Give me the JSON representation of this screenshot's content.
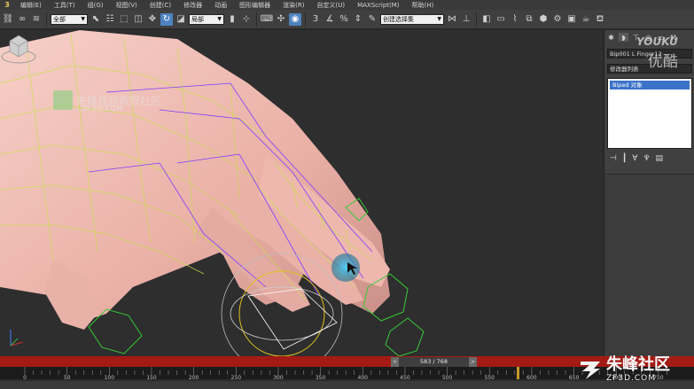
{
  "menubar": {
    "app_logo": "3",
    "items": [
      "编辑(E)",
      "工具(T)",
      "组(G)",
      "视图(V)",
      "创建(C)",
      "修改器",
      "动画",
      "图形编辑器",
      "渲染(R)",
      "自定义(U)",
      "MAXScript(M)",
      "帮助(H)"
    ]
  },
  "toolbar": {
    "selection_filter": "全部",
    "coord_system": "局部",
    "named_selection": "创建选择集",
    "spinner_snap_label": "3",
    "percent_snap_label": "%"
  },
  "viewport": {
    "watermark_text": "朱峰视频教程社区",
    "watermark_sub": "ZF3D.COM",
    "bg_color": "#2e2e2e",
    "mesh_color": "#c8e04a",
    "bone_color": "#7c3cff",
    "skin_color": "#f1b8ae"
  },
  "command_panel": {
    "tabs": [
      "create-icon",
      "modify-icon",
      "hierarchy-icon",
      "motion-icon",
      "display-icon",
      "utilities-icon"
    ],
    "object_name": "Bip001 L Finger13",
    "modifier_list": "修改器列表",
    "stack_item": "Biped 对象",
    "stack_icons": [
      "pin-icon",
      "show-end-icon",
      "make-unique-icon",
      "remove-modifier-icon",
      "configure-icon"
    ]
  },
  "timeline": {
    "frame_label": "583 / 768",
    "prev_label": "<",
    "next_label": ">",
    "current_frame": 583,
    "total_frames": 768,
    "ticks": [
      "0",
      "50",
      "100",
      "150",
      "200",
      "250",
      "300",
      "350",
      "400",
      "450",
      "500",
      "550",
      "600",
      "650",
      "700",
      "750"
    ],
    "bar_color": "#a31b14"
  },
  "brand": {
    "youku_logo": "YOUKU",
    "youku_cn": "优酷",
    "zf_cn": "朱峰社区",
    "zf_en": "ZF3D.COM"
  }
}
